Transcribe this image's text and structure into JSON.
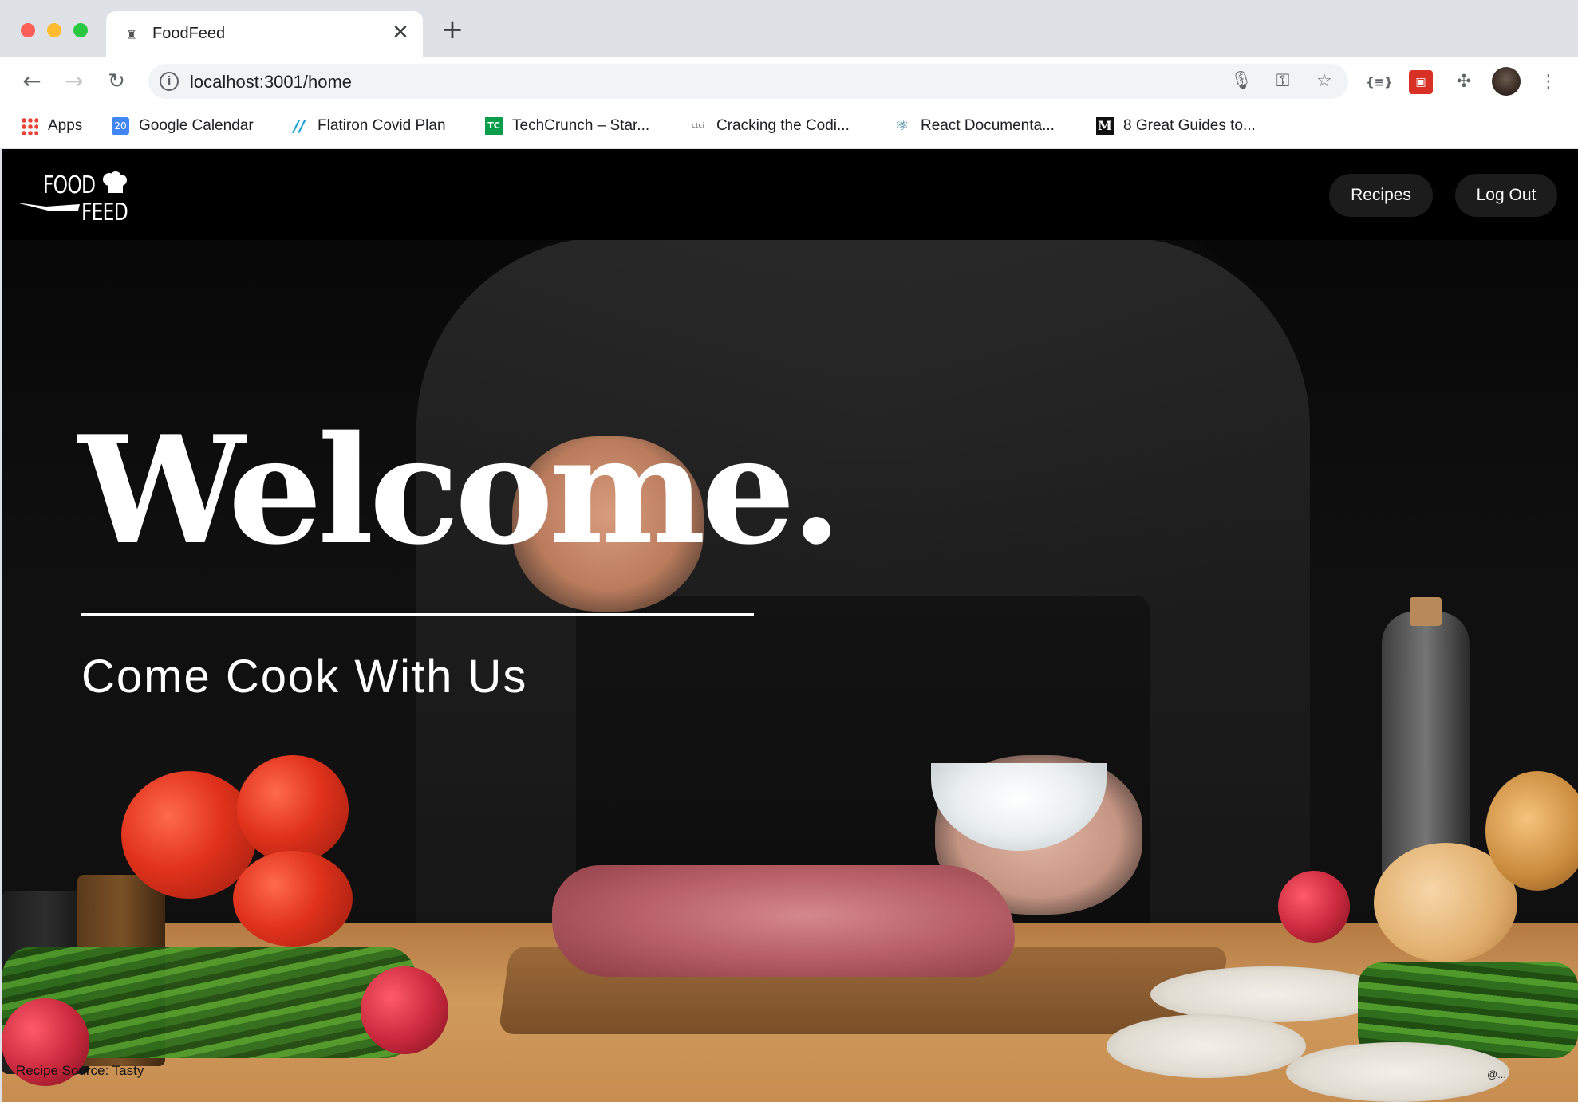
{
  "browser": {
    "tab": {
      "title": "FoodFeed",
      "close_glyph": "✕",
      "favicon": "chef-hat-icon"
    },
    "new_tab_glyph": "+",
    "address": {
      "url": "localhost:3001/home"
    },
    "bookmarks": [
      {
        "label": "Apps",
        "icon": "apps-grid-icon"
      },
      {
        "label": "Google Calendar",
        "icon": "google-calendar-icon",
        "badge": "20"
      },
      {
        "label": "Flatiron Covid Plan",
        "icon": "flatiron-icon",
        "badge": "//"
      },
      {
        "label": "TechCrunch – Star...",
        "icon": "techcrunch-icon",
        "badge": "TC"
      },
      {
        "label": "Cracking the Codi...",
        "icon": "ctci-icon",
        "badge": "ctci"
      },
      {
        "label": "React Documenta...",
        "icon": "react-icon",
        "badge": "⚛"
      },
      {
        "label": "8 Great Guides to...",
        "icon": "medium-icon",
        "badge": "M"
      }
    ]
  },
  "site": {
    "brand_top": "FOOD",
    "brand_bottom": "FEED",
    "nav": {
      "recipes": "Recipes",
      "logout": "Log Out"
    },
    "hero": {
      "title": "Welcome.",
      "subtitle": "Come Cook With Us",
      "credit": "Recipe Source: Tasty",
      "watermark": "@..."
    }
  },
  "colors": {
    "nav_bg": "#000000",
    "pill_bg": "#1c1c1c",
    "text": "#ffffff"
  }
}
